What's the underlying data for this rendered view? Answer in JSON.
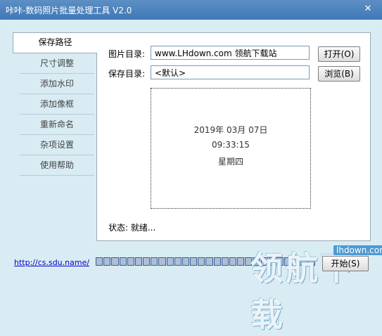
{
  "window": {
    "title": "咔咔-数码照片批量处理工具 V2.0",
    "close_glyph": "✕"
  },
  "sidebar": {
    "items": [
      {
        "label": "保存路径",
        "active": true
      },
      {
        "label": "尺寸调整"
      },
      {
        "label": "添加水印"
      },
      {
        "label": "添加像框"
      },
      {
        "label": "重新命名"
      },
      {
        "label": "杂项设置"
      },
      {
        "label": "使用帮助"
      }
    ]
  },
  "panel": {
    "image_dir_label": "图片目录:",
    "image_dir_value": "www.LHdown.com 领航下载站",
    "open_button": "打开(O)",
    "save_dir_label": "保存目录:",
    "save_dir_value": "<默认>",
    "browse_button": "浏览(B)",
    "preview": {
      "date": "2019年 03月 07日",
      "time": "09:33:15",
      "weekday": "星期四"
    },
    "status": "状态: 就绪..."
  },
  "footer": {
    "link": "http://cs.sdu.name/",
    "start_button": "开始(S)",
    "progress_cells": 28
  },
  "watermark": {
    "text": "领航下载",
    "site": "lhdown.com"
  },
  "colors": {
    "background": "#d9ecf3",
    "titlebar": "#4a82bd",
    "link": "#0000cc",
    "progress": "#35609a"
  }
}
